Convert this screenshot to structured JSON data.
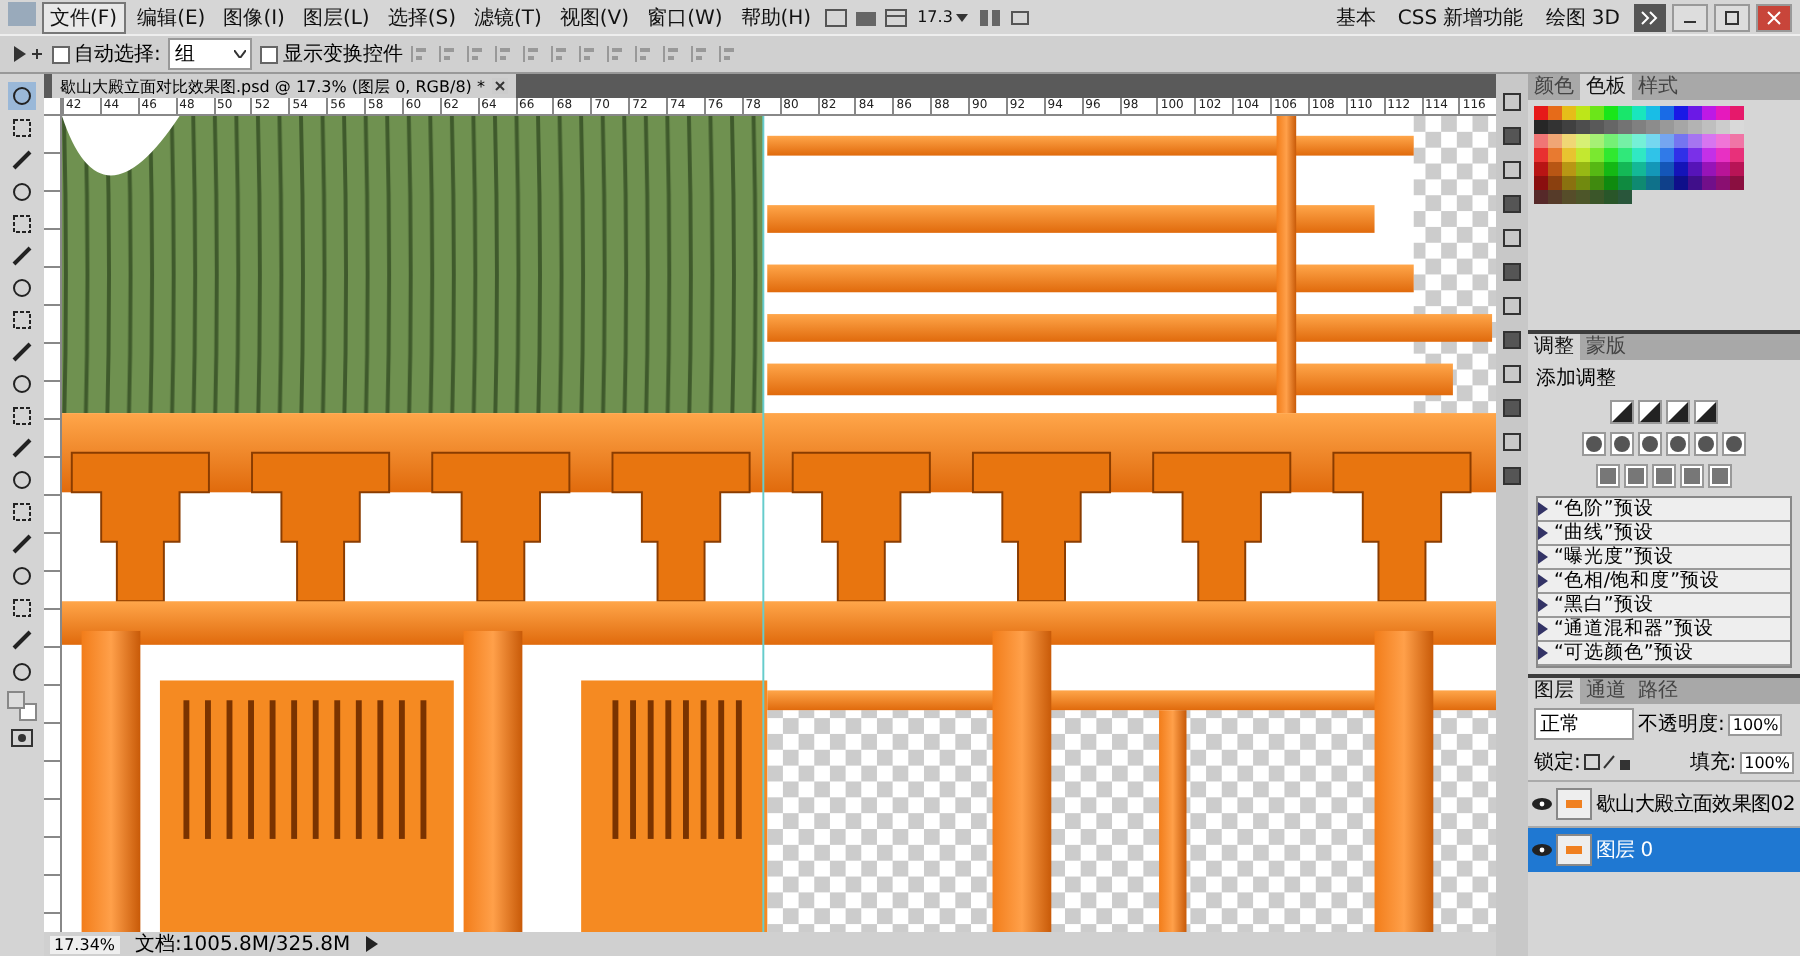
{
  "menu": [
    {
      "label": "文件(F)",
      "selected": true
    },
    {
      "label": "编辑(E)",
      "selected": false
    },
    {
      "label": "图像(I)",
      "selected": false
    },
    {
      "label": "图层(L)",
      "selected": false
    },
    {
      "label": "选择(S)",
      "selected": false
    },
    {
      "label": "滤镜(T)",
      "selected": false
    },
    {
      "label": "视图(V)",
      "selected": false
    },
    {
      "label": "窗口(W)",
      "selected": false
    },
    {
      "label": "帮助(H)",
      "selected": false
    }
  ],
  "app_bar": {
    "zoom": "17.3",
    "workspaces": [
      "基本",
      "CSS 新增功能",
      "绘图 3D"
    ]
  },
  "options": {
    "auto_select": {
      "label": "自动选择:",
      "checked": false,
      "value": "组"
    },
    "transform": {
      "label": "显示变换控件",
      "checked": false
    }
  },
  "document": {
    "tab_title": "歇山大殿立面对比效果图.psd @ 17.3% (图层 0, RGB/8) *",
    "ruler_marks": [
      "42",
      "44",
      "46",
      "48",
      "50",
      "52",
      "54",
      "56",
      "58",
      "60",
      "62",
      "64",
      "66",
      "68",
      "70",
      "72",
      "74",
      "76",
      "78",
      "80",
      "82",
      "84",
      "86",
      "88",
      "90",
      "92",
      "94",
      "96",
      "98",
      "100",
      "102",
      "104",
      "106",
      "108",
      "110",
      "112",
      "114",
      "116"
    ]
  },
  "swatches_panel": {
    "tabs": [
      {
        "label": "颜色",
        "selected": false
      },
      {
        "label": "色板",
        "selected": true
      },
      {
        "label": "样式",
        "selected": false
      }
    ]
  },
  "adjustments_panel": {
    "tabs": [
      {
        "label": "调整",
        "selected": true
      },
      {
        "label": "蒙版",
        "selected": false
      }
    ],
    "title": "添加调整",
    "presets": [
      "“色阶”预设",
      "“曲线”预设",
      "“曝光度”预设",
      "“色相/饱和度”预设",
      "“黑白”预设",
      "“通道混和器”预设",
      "“可选颜色”预设"
    ]
  },
  "layers_panel": {
    "tabs": [
      {
        "label": "图层",
        "selected": true
      },
      {
        "label": "通道",
        "selected": false
      },
      {
        "label": "路径",
        "selected": false
      }
    ],
    "blend_mode": "正常",
    "opacity_label": "不透明度:",
    "opacity": "100%",
    "lock_label": "锁定:",
    "fill_label": "填充:",
    "fill": "100%",
    "layers": [
      {
        "name": "歇山大殿立面效果图02",
        "selected": false,
        "visible": true
      },
      {
        "name": "图层 0",
        "selected": true,
        "visible": true
      }
    ]
  },
  "status_bar": {
    "zoom": "17.34%",
    "document_size": "文档:1005.8M/325.8M"
  }
}
